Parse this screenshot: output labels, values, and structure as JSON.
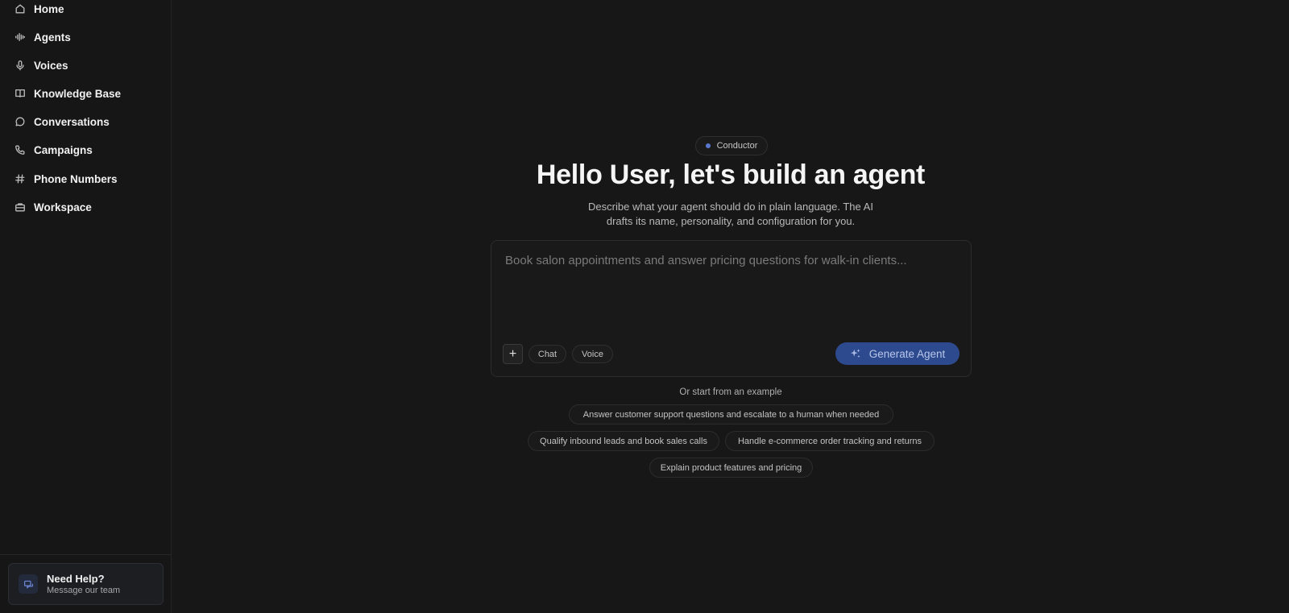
{
  "sidebar": {
    "items": [
      {
        "label": "Home",
        "icon": "home-icon"
      },
      {
        "label": "Agents",
        "icon": "waveform-icon"
      },
      {
        "label": "Voices",
        "icon": "microphone-icon"
      },
      {
        "label": "Knowledge Base",
        "icon": "book-icon"
      },
      {
        "label": "Conversations",
        "icon": "chat-bubble-icon"
      },
      {
        "label": "Campaigns",
        "icon": "phone-icon"
      },
      {
        "label": "Phone Numbers",
        "icon": "hash-icon"
      },
      {
        "label": "Workspace",
        "icon": "briefcase-icon"
      }
    ],
    "help": {
      "title": "Need Help?",
      "subtitle": "Message our team",
      "icon": "message-icon"
    }
  },
  "main": {
    "badge": "Conductor",
    "title": "Hello User, let's build an agent",
    "subtitle_line1": "Describe what your agent should do in plain language. The AI",
    "subtitle_line2": "drafts its name, personality, and configuration for you.",
    "composer": {
      "placeholder": "Book salon appointments and answer pricing questions for walk-in clients...",
      "value": "",
      "plus_label": "+",
      "modes": [
        "Chat",
        "Voice"
      ],
      "generate_label": "Generate Agent"
    },
    "examples_label": "Or start from an example",
    "examples": [
      "Answer customer support questions and escalate to a human when needed",
      "Qualify inbound leads and book sales calls",
      "Handle e-commerce order tracking and returns",
      "Explain product features and pricing"
    ]
  },
  "colors": {
    "background": "#171717",
    "accent": "#2e4a8e",
    "accent_dot": "#5b78d0"
  }
}
